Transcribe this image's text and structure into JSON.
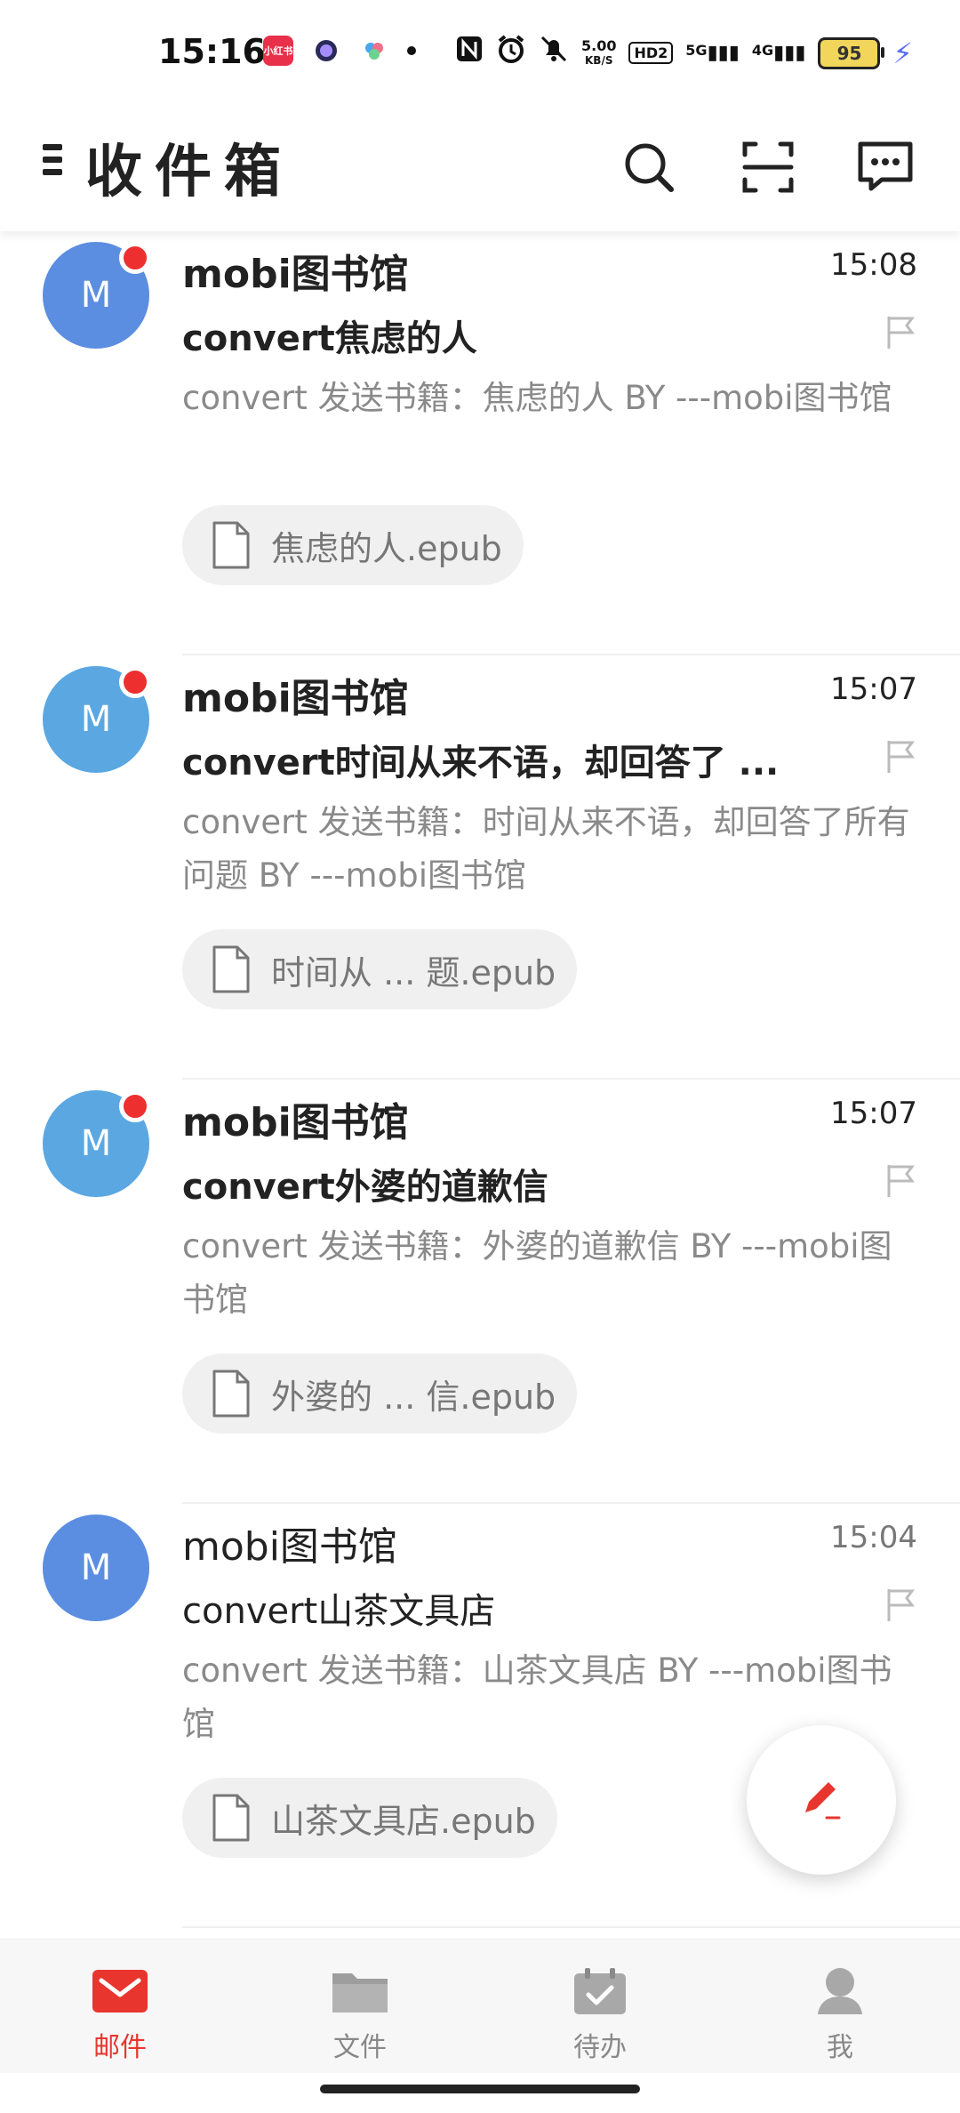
{
  "status_bar": {
    "time": "15:16",
    "app_badge": "小红书",
    "net_speed_top": "5.00",
    "net_speed_bottom": "KB/S",
    "hd": "HD2",
    "sig5g": "5G",
    "sig4g": "4G",
    "battery": "95"
  },
  "header": {
    "title": "收件箱",
    "icons": [
      "menu-icon",
      "search-icon",
      "scan-icon",
      "message-icon"
    ]
  },
  "mails": [
    {
      "avatar": "M",
      "avatar_color": "#5b8ee0",
      "unread": true,
      "sender": "mobi图书馆",
      "time": "15:08",
      "subject": "convert焦虑的人",
      "preview": "convert 发送书籍：焦虑的人 BY ---mobi图书馆",
      "attachment": "焦虑的人.epub"
    },
    {
      "avatar": "M",
      "avatar_color": "#5aa7e2",
      "unread": true,
      "sender": "mobi图书馆",
      "time": "15:07",
      "subject": "convert时间从来不语，却回答了 ...",
      "preview": "convert 发送书籍：时间从来不语，却回答了所有问题 BY ---mobi图书馆",
      "attachment": "时间从 ... 题.epub"
    },
    {
      "avatar": "M",
      "avatar_color": "#5aa7e2",
      "unread": true,
      "sender": "mobi图书馆",
      "time": "15:07",
      "subject": "convert外婆的道歉信",
      "preview": "convert 发送书籍：外婆的道歉信 BY ---mobi图书馆",
      "attachment": "外婆的 ... 信.epub"
    },
    {
      "avatar": "M",
      "avatar_color": "#5b8ee0",
      "unread": false,
      "sender": "mobi图书馆",
      "time": "15:04",
      "subject": "convert山茶文具店",
      "preview": "convert 发送书籍：山茶文具店 BY ---mobi图书馆",
      "attachment": "山茶文具店.epub"
    }
  ],
  "bottom_nav": [
    {
      "label": "邮件",
      "active": true,
      "icon": "mail-icon"
    },
    {
      "label": "文件",
      "active": false,
      "icon": "folder-icon"
    },
    {
      "label": "待办",
      "active": false,
      "icon": "calendar-check-icon"
    },
    {
      "label": "我",
      "active": false,
      "icon": "user-icon"
    }
  ],
  "colors": {
    "accent": "#e8362f",
    "unread_dot": "#ee2f2f",
    "preview_text": "#8a8a8a"
  }
}
